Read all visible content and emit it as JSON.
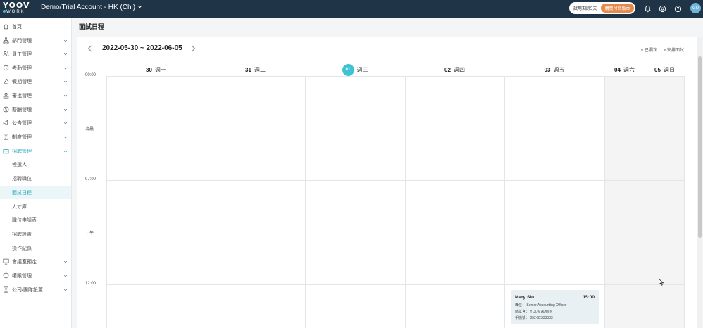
{
  "topbar": {
    "logo_line1": "YOOV",
    "logo_line2": "WORK",
    "account": "Demo/Trial Account - HK (Chi)",
    "trial_text": "試用剩餘5天",
    "upgrade_label": "購買付費版本",
    "avatar_text": "GU",
    "icons": [
      "bell-icon",
      "settings-circle-icon",
      "help-icon"
    ]
  },
  "sidebar": {
    "items": [
      {
        "label": "首頁",
        "icon": "home-icon",
        "chevron": false
      },
      {
        "label": "部門管理",
        "icon": "org-icon",
        "chevron": true
      },
      {
        "label": "員工管理",
        "icon": "users-icon",
        "chevron": true
      },
      {
        "label": "考勤管理",
        "icon": "clock-icon",
        "chevron": true
      },
      {
        "label": "假期管理",
        "icon": "leave-icon",
        "chevron": true
      },
      {
        "label": "審批管理",
        "icon": "approval-icon",
        "chevron": true
      },
      {
        "label": "薪酬管理",
        "icon": "dollar-icon",
        "chevron": true
      },
      {
        "label": "公告管理",
        "icon": "megaphone-icon",
        "chevron": true
      },
      {
        "label": "制度管理",
        "icon": "document-icon",
        "chevron": true
      },
      {
        "label": "招聘管理",
        "icon": "briefcase-icon",
        "chevron": true,
        "expanded": true
      }
    ],
    "sub_items": [
      {
        "label": "候選人"
      },
      {
        "label": "招聘職位"
      },
      {
        "label": "面試日程",
        "active": true
      },
      {
        "label": "人才庫"
      },
      {
        "label": "職位申請表"
      },
      {
        "label": "招聘設置"
      },
      {
        "label": "操作紀錄"
      }
    ],
    "bottom_items": [
      {
        "label": "會議室預定",
        "icon": "meeting-room-icon",
        "chevron": true
      },
      {
        "label": "權限管理",
        "icon": "shield-icon",
        "chevron": true
      },
      {
        "label": "公司/團隊設置",
        "icon": "building-icon",
        "chevron": true
      }
    ]
  },
  "main": {
    "page_title": "面試日程",
    "date_range": "2022-05-30 ~ 2022-06-05",
    "legend": [
      "已漏次",
      "安排面試"
    ],
    "days": [
      {
        "num": "30",
        "weekday": "週一",
        "today": false,
        "weekend": false
      },
      {
        "num": "31",
        "weekday": "週二",
        "today": false,
        "weekend": false
      },
      {
        "num": "01",
        "weekday": "週三",
        "today": true,
        "weekend": false
      },
      {
        "num": "02",
        "weekday": "週四",
        "today": false,
        "weekend": false
      },
      {
        "num": "03",
        "weekday": "週五",
        "today": false,
        "weekend": false
      },
      {
        "num": "04",
        "weekday": "週六",
        "today": false,
        "weekend": true
      },
      {
        "num": "05",
        "weekday": "週日",
        "today": false,
        "weekend": true
      }
    ],
    "time_labels": [
      "00:00",
      "凌晨",
      "07:00",
      "上午",
      "12:00"
    ],
    "event": {
      "name": "Mary Siu",
      "time": "15:00",
      "position": "職位： Senior Accounting Officer",
      "interviewer": "面試官： YOOV ADMIN",
      "phone": "手機號： 852-62333333"
    }
  },
  "colors": {
    "topbar": "#1f3447",
    "accent": "#3ec3d5",
    "upgrade": "#e48a4a",
    "active_menu": "#2aa6b8"
  }
}
